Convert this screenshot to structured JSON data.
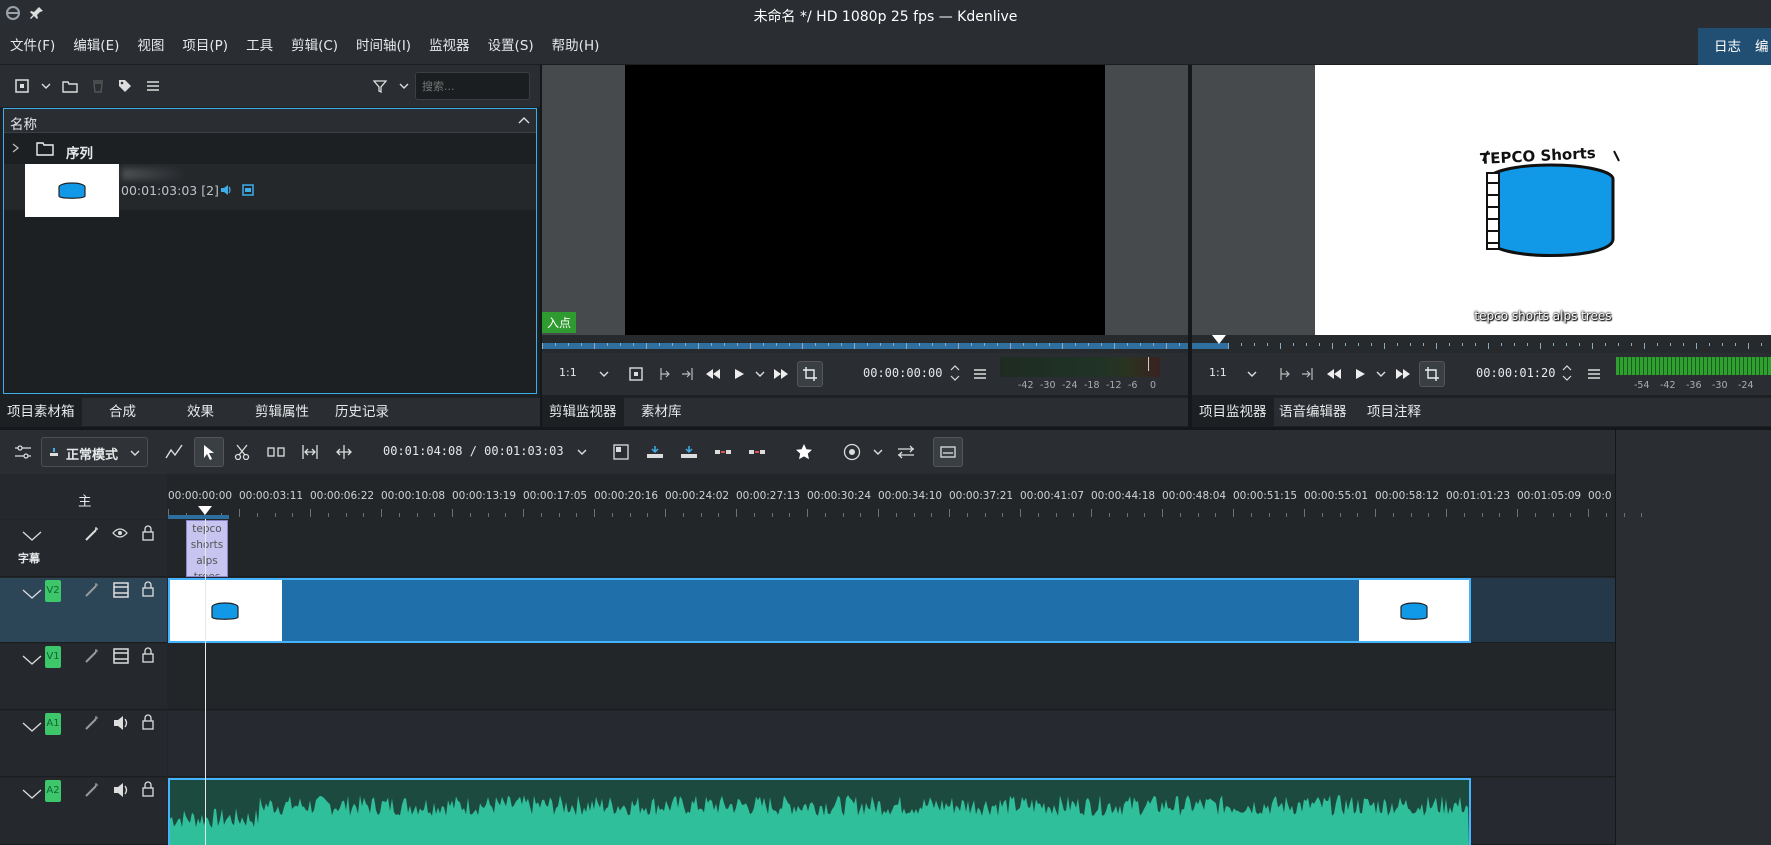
{
  "window": {
    "title": "未命名 */ HD 1080p 25 fps — Kdenlive"
  },
  "menu": [
    "文件(F)",
    "编辑(E)",
    "视图",
    "项目(P)",
    "工具",
    "剪辑(C)",
    "时间轴(I)",
    "监视器",
    "设置(S)",
    "帮助(H)"
  ],
  "menu_right": {
    "log": "日志",
    "edit": "编辑"
  },
  "bin": {
    "search_placeholder": "搜索...",
    "column_header": "名称",
    "folder_name": "序列",
    "clip_duration": "00:01:03:03 [2]"
  },
  "left_tabs": [
    "项目素材箱",
    "合成",
    "效果",
    "剪辑属性",
    "历史记录"
  ],
  "clip_monitor": {
    "in_point": "入点",
    "zoom": "1:1",
    "timecode": "00:00:00:00",
    "vu_scale": [
      "-42",
      "-30",
      "-24",
      "-18",
      "-12",
      "-6",
      "0"
    ],
    "tabs": [
      "剪辑监视器",
      "素材库"
    ]
  },
  "project_monitor": {
    "logo_title": "TEPCO Shorts",
    "subtitle_overlay": "tepco shorts alps trees",
    "zoom": "1:1",
    "timecode": "00:00:01:20",
    "vu_scale": [
      "-54",
      "-42",
      "-36",
      "-30",
      "-24"
    ],
    "tabs": [
      "项目监视器",
      "语音编辑器",
      "项目注释"
    ]
  },
  "timeline_toolbar": {
    "mode": "正常模式",
    "position": "00:01:04:08 / 00:01:03:03"
  },
  "timeline": {
    "master_label": "主",
    "ruler": [
      "00:00:00:00",
      "00:00:03:11",
      "00:00:06:22",
      "00:00:10:08",
      "00:00:13:19",
      "00:00:17:05",
      "00:00:20:16",
      "00:00:24:02",
      "00:00:27:13",
      "00:00:30:24",
      "00:00:34:10",
      "00:00:37:21",
      "00:00:41:07",
      "00:00:44:18",
      "00:00:48:04",
      "00:00:51:15",
      "00:00:55:01",
      "00:00:58:12",
      "00:01:01:23",
      "00:01:05:09",
      "00:0"
    ],
    "subtitle_track_label": "字幕",
    "subtitle_clip_text": "tepco\nshorts\nalps\ntrees",
    "tracks": [
      {
        "name": "V2",
        "kind": "video"
      },
      {
        "name": "V1",
        "kind": "video"
      },
      {
        "name": "A1",
        "kind": "audio"
      },
      {
        "name": "A2",
        "kind": "audio"
      }
    ]
  },
  "colors": {
    "accent": "#3daee9",
    "clip_blue": "#1f6fab",
    "audio_green": "#2fbf9a",
    "badge_green": "#3ec66b"
  }
}
